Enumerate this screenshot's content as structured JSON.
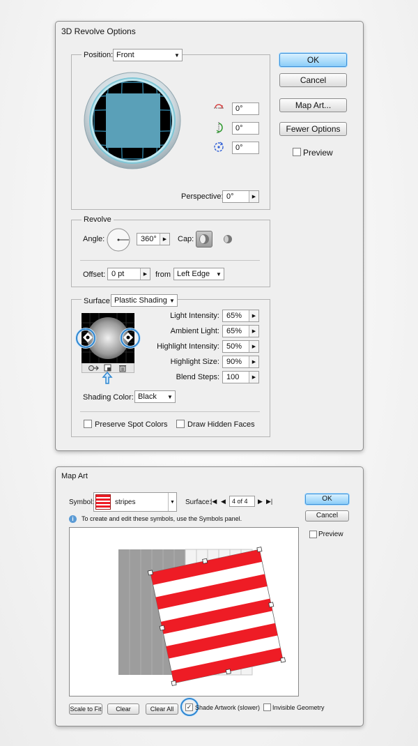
{
  "revolve_dialog": {
    "title": "3D Revolve Options",
    "position": {
      "label": "Position:",
      "value": "Front",
      "rotations": [
        {
          "icon": "rotate-x-icon",
          "color": "#d64545",
          "value": "0°"
        },
        {
          "icon": "rotate-y-icon",
          "color": "#2f9a2f",
          "value": "0°"
        },
        {
          "icon": "rotate-z-icon",
          "color": "#2f5fd6",
          "value": "0°"
        }
      ],
      "perspective_label": "Perspective:",
      "perspective_value": "0°"
    },
    "revolve": {
      "label": "Revolve",
      "angle_label": "Angle:",
      "angle_value": "360°",
      "cap_label": "Cap:",
      "offset_label": "Offset:",
      "offset_value": "0 pt",
      "from_label": "from",
      "from_value": "Left Edge"
    },
    "surface": {
      "label": "Surface:",
      "value": "Plastic Shading",
      "settings": [
        {
          "label": "Light Intensity:",
          "value": "65%"
        },
        {
          "label": "Ambient Light:",
          "value": "65%"
        },
        {
          "label": "Highlight Intensity:",
          "value": "50%"
        },
        {
          "label": "Highlight Size:",
          "value": "90%"
        },
        {
          "label": "Blend Steps:",
          "value": "100"
        }
      ],
      "shading_color_label": "Shading Color:",
      "shading_color_value": "Black",
      "preserve_spot_label": "Preserve Spot Colors",
      "draw_hidden_label": "Draw Hidden Faces"
    },
    "buttons": {
      "ok": "OK",
      "cancel": "Cancel",
      "map_art": "Map Art...",
      "fewer_options": "Fewer Options",
      "preview": "Preview"
    }
  },
  "map_art_dialog": {
    "title": "Map Art",
    "symbol_label": "Symbol:",
    "symbol_value": "stripes",
    "surface_label": "Surface:",
    "surface_value": "4 of 4",
    "info_text": "To create and edit these symbols, use the Symbols panel.",
    "buttons": {
      "ok": "OK",
      "cancel": "Cancel",
      "preview": "Preview",
      "scale_to_fit": "Scale to Fit",
      "clear": "Clear",
      "clear_all": "Clear All"
    },
    "shade_artwork_label": "Shade Artwork (slower)",
    "shade_artwork_checked": true,
    "invisible_geometry_label": "Invisible Geometry",
    "stripe_color": "#ee1c25"
  },
  "colors": {
    "accent": "#2f87d1",
    "sphere_preview": "#5aa0b8"
  }
}
